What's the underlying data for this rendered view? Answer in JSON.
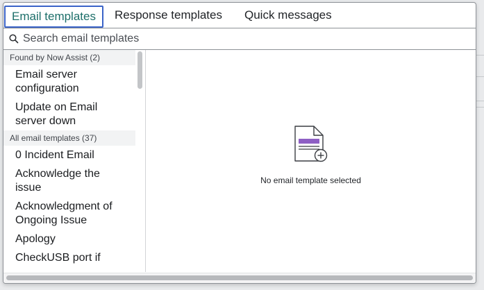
{
  "tabs": [
    {
      "label": "Email templates",
      "active": true
    },
    {
      "label": "Response templates",
      "active": false
    },
    {
      "label": "Quick messages",
      "active": false
    }
  ],
  "search": {
    "placeholder": "Search email templates",
    "value": ""
  },
  "groups": [
    {
      "header": "Found by Now Assist (2)",
      "items": [
        "Email server configuration",
        "Update on Email server down"
      ]
    },
    {
      "header": "All email templates (37)",
      "items": [
        "0 Incident Email",
        "Acknowledge the issue",
        "Acknowledgment of Ongoing Issue",
        "Apology",
        "CheckUSB port if"
      ]
    }
  ],
  "empty_state": {
    "message": "No email template selected",
    "icon": "document-add-icon"
  },
  "colors": {
    "active_tab_text": "#1d6f6a",
    "active_tab_border": "#3a63c8",
    "icon_accent": "#8e5fc4"
  }
}
